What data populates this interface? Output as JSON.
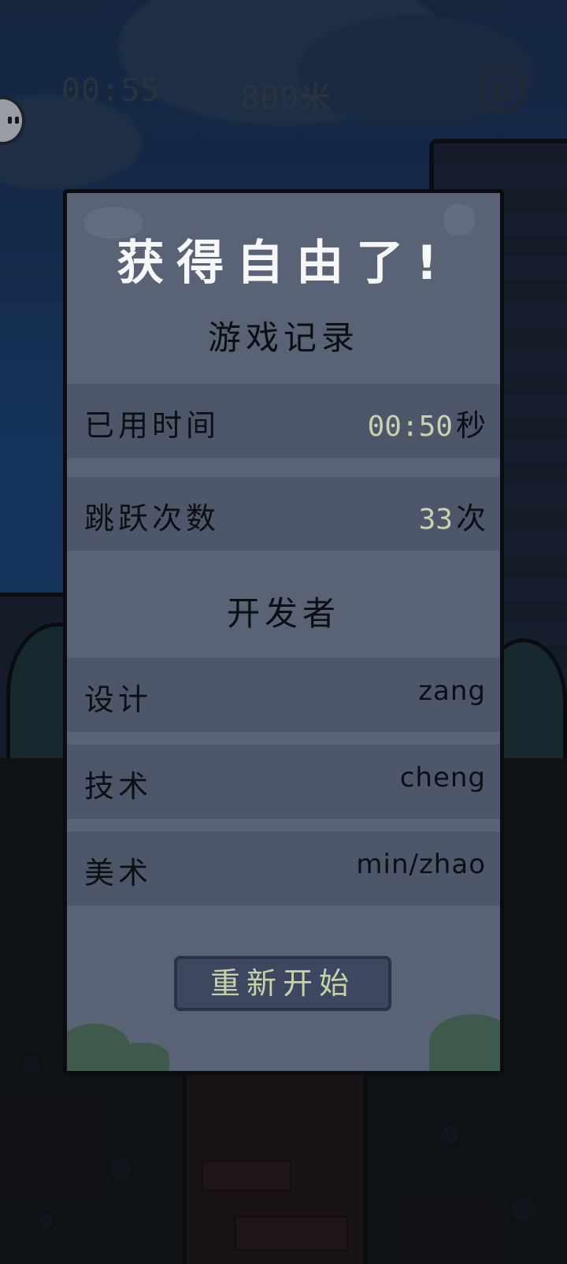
{
  "hud": {
    "timer": "00:55",
    "distance": "800米"
  },
  "result": {
    "title": "获得自由了!",
    "record_heading": "游戏记录",
    "stats": [
      {
        "label": "已用时间",
        "value": "00:50",
        "unit": "秒"
      },
      {
        "label": "跳跃次数",
        "value": "33",
        "unit": "次"
      }
    ],
    "dev_heading": "开发者",
    "developers": [
      {
        "role": "设计",
        "name": "zang"
      },
      {
        "role": "技术",
        "name": "cheng"
      },
      {
        "role": "美术",
        "name": "min/zhao"
      }
    ],
    "restart_label": "重新开始"
  },
  "colors": {
    "panel": "#5a6276",
    "row": "#4e566a",
    "value_accent": "#c9d2ad",
    "button": "#3d4760"
  }
}
